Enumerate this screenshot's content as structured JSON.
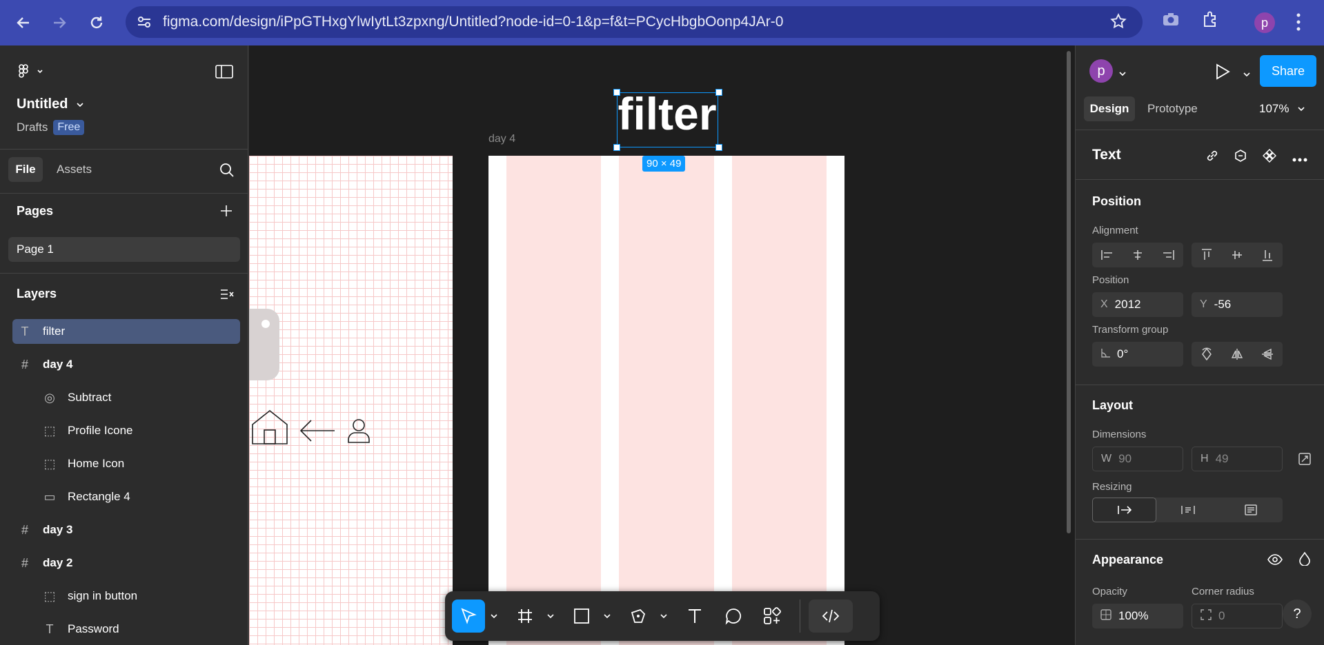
{
  "browser": {
    "url": "figma.com/design/iPpGTHxgYlwIytLt3zpxng/Untitled?node-id=0-1&p=f&t=PCycHbgbOonp4JAr-0",
    "profile_initial": "p"
  },
  "left_panel": {
    "file_title": "Untitled",
    "drafts_label": "Drafts",
    "plan_badge": "Free",
    "tabs": [
      "File",
      "Assets"
    ],
    "pages_heading": "Pages",
    "pages": [
      "Page 1"
    ],
    "layers_heading": "Layers",
    "layers": [
      {
        "icon": "T",
        "label": "filter",
        "selected": true
      },
      {
        "icon": "#",
        "label": "day 4",
        "selected": false
      },
      {
        "icon": "◎",
        "label": "Subtract",
        "selected": false
      },
      {
        "icon": "⬚",
        "label": "Profile Icone",
        "selected": false
      },
      {
        "icon": "⬚",
        "label": "Home Icon",
        "selected": false
      },
      {
        "icon": "▭",
        "label": "Rectangle 4",
        "selected": false
      },
      {
        "icon": "#",
        "label": "day 3",
        "selected": false
      },
      {
        "icon": "#",
        "label": "day 2",
        "selected": false
      },
      {
        "icon": "⬚",
        "label": "sign in button",
        "selected": false
      },
      {
        "icon": "T",
        "label": "Password",
        "selected": false
      }
    ]
  },
  "canvas": {
    "frame_label": "day 4",
    "text_layer": "filter",
    "dimension_badge": "90 × 49"
  },
  "right_panel": {
    "user_initial": "p",
    "share_label": "Share",
    "tabs": [
      "Design",
      "Prototype"
    ],
    "zoom": "107%",
    "section_title": "Text",
    "position_heading": "Position",
    "alignment_label": "Alignment",
    "position_label": "Position",
    "x_prefix": "X",
    "x_value": "2012",
    "y_prefix": "Y",
    "y_value": "-56",
    "transform_label": "Transform group",
    "rotation_value": "0°",
    "layout_heading": "Layout",
    "dimensions_label": "Dimensions",
    "w_prefix": "W",
    "w_value": "90",
    "h_prefix": "H",
    "h_value": "49",
    "resizing_label": "Resizing",
    "appearance_heading": "Appearance",
    "opacity_label": "Opacity",
    "opacity_value": "100%",
    "corner_label": "Corner radius",
    "corner_value": "0",
    "help_label": "?"
  },
  "colors": {
    "browser_bar": "#3c4ab1",
    "panel_bg": "#2c2c2c",
    "canvas_bg": "#1e1e1e",
    "selection": "#0d99ff",
    "frame_column": "#fde3e1",
    "badge_free": "#3a5a9c"
  }
}
